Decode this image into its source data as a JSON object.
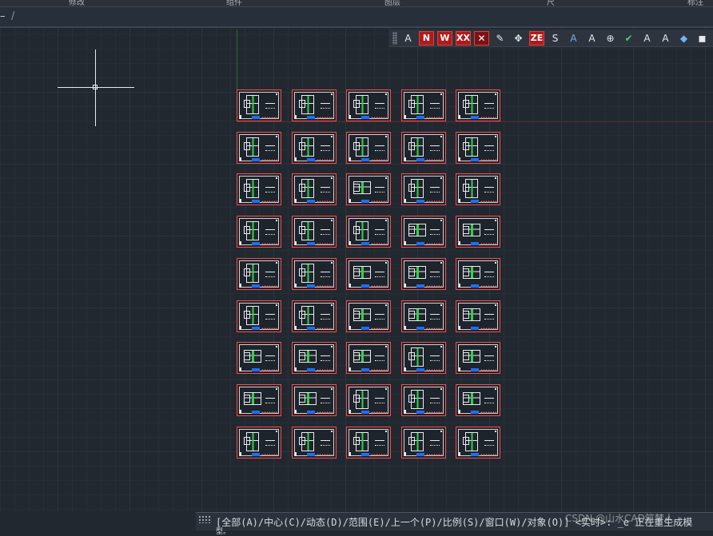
{
  "menu_strip": [
    "修改",
    "组件",
    "图层",
    "尺",
    "标注"
  ],
  "tabs": {
    "dash": "–",
    "slash": "/"
  },
  "toolbar": {
    "buttons": [
      {
        "label": "A",
        "icon": "text-a-icon",
        "style": "plain"
      },
      {
        "label": "N",
        "icon": "text-n-icon",
        "style": "red"
      },
      {
        "label": "W",
        "icon": "text-w-icon",
        "style": "red"
      },
      {
        "label": "XX",
        "icon": "delete-text-icon",
        "style": "red"
      },
      {
        "label": "✕",
        "icon": "remove-icon",
        "style": "redx"
      },
      {
        "label": "✎",
        "icon": "brush-icon",
        "style": "plain"
      },
      {
        "label": "✥",
        "icon": "move-icon",
        "style": "plain"
      },
      {
        "label": "ZE",
        "icon": "text-ze-icon",
        "style": "red"
      },
      {
        "label": "S",
        "icon": "text-s-icon",
        "style": "plain"
      },
      {
        "label": "A",
        "icon": "text-underline-icon",
        "style": "blue"
      },
      {
        "label": "A",
        "icon": "text-edit-icon",
        "style": "plain"
      },
      {
        "label": "⊕",
        "icon": "zoom-text-icon",
        "style": "plain"
      },
      {
        "label": "✔",
        "icon": "spellcheck-icon",
        "style": "green"
      },
      {
        "label": "A",
        "icon": "text-style-icon",
        "style": "plain"
      },
      {
        "label": "A",
        "icon": "text-align-icon",
        "style": "plain"
      },
      {
        "label": "◆",
        "icon": "blocks-icon",
        "style": "blue"
      },
      {
        "label": "◼",
        "icon": "layers-icon",
        "style": "plain"
      }
    ]
  },
  "drawing_grid": {
    "rows": [
      [
        "tall",
        "tall",
        "tall",
        "tall",
        "tall"
      ],
      [
        "tall",
        "tall",
        "tall",
        "tall",
        "tall"
      ],
      [
        "tall",
        "tall",
        "wide",
        "tall",
        "tall"
      ],
      [
        "tall",
        "tall",
        "tall",
        "wide",
        "wide"
      ],
      [
        "tall",
        "tall",
        "wide",
        "wide",
        "wide"
      ],
      [
        "tall",
        "tall",
        "wide",
        "wide",
        "wide"
      ],
      [
        "wide",
        "wide",
        "wide",
        "tall",
        "wide"
      ],
      [
        "wide",
        "wide",
        "tall",
        "tall",
        "wide"
      ],
      [
        "tall",
        "tall",
        "tall",
        "tall",
        "tall"
      ]
    ]
  },
  "command_line": {
    "prompt": "[全部(A)/中心(C)/动态(D)/范围(E)/上一个(P)/比例(S)/窗口(W)/对象(O)] <实时>: _e 正在重生成模",
    "continuation": "型。"
  },
  "watermark": "CSDN @山水CAD筑梦人"
}
